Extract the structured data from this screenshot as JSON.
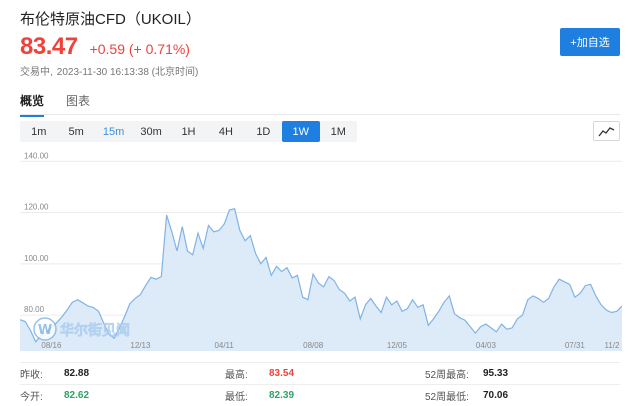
{
  "header": {
    "title": "布伦特原油CFD（UKOIL）",
    "price": "83.47",
    "change": "+0.59 (+ 0.71%)",
    "status_label": "交易中,",
    "timestamp": "2023-11-30 16:13:38 (北京时间)",
    "add_button_label": "+加自选"
  },
  "tabs": [
    {
      "label": "概览",
      "active": true
    },
    {
      "label": "图表",
      "active": false
    }
  ],
  "periods": [
    {
      "label": "1m"
    },
    {
      "label": "5m"
    },
    {
      "label": "15m",
      "highlight": true
    },
    {
      "label": "30m"
    },
    {
      "label": "1H"
    },
    {
      "label": "4H"
    },
    {
      "label": "1D"
    },
    {
      "label": "1W",
      "active": true
    },
    {
      "label": "1M"
    }
  ],
  "chart_type_icon": "line-chart-icon",
  "watermark": "华尔街见闻",
  "colors": {
    "up": "#f0413b",
    "down": "#2ea266",
    "accent": "#1e7fe0",
    "area_fill": "#ddebf9",
    "area_line": "#7fb3e6"
  },
  "chart_data": {
    "type": "area",
    "title": "",
    "xlabel": "",
    "ylabel": "",
    "y_ticks": [
      "140.00",
      "120.00",
      "100.00",
      "80.00"
    ],
    "x_ticks": [
      {
        "label": "08/16",
        "index": 6
      },
      {
        "label": "12/13",
        "index": 23
      },
      {
        "label": "04/11",
        "index": 39
      },
      {
        "label": "08/08",
        "index": 56
      },
      {
        "label": "12/05",
        "index": 72
      },
      {
        "label": "04/03",
        "index": 89
      },
      {
        "label": "07/31",
        "index": 106
      },
      {
        "label": "11/2",
        "index": 122
      }
    ],
    "ylim": [
      66,
      144
    ],
    "grid": true,
    "values": [
      78.2,
      77.5,
      74.0,
      69.6,
      72.0,
      73.6,
      75.3,
      77.0,
      79.3,
      82.0,
      85.0,
      86.0,
      84.8,
      83.5,
      83.0,
      81.5,
      76.8,
      72.5,
      71.0,
      75.0,
      79.5,
      84.5,
      86.5,
      88.0,
      91.5,
      94.7,
      94.0,
      95.0,
      119.0,
      112.5,
      105.0,
      114.5,
      105.0,
      103.5,
      112.0,
      106.0,
      115.0,
      112.5,
      113.0,
      115.5,
      121.0,
      121.5,
      113.0,
      109.0,
      111.0,
      104.0,
      100.0,
      102.5,
      95.5,
      99.0,
      97.0,
      98.5,
      94.5,
      95.5,
      87.0,
      86.0,
      96.0,
      92.5,
      91.0,
      95.0,
      93.5,
      90.0,
      88.5,
      85.5,
      87.0,
      78.5,
      84.0,
      86.5,
      83.5,
      81.0,
      87.0,
      84.0,
      85.5,
      81.5,
      82.5,
      86.0,
      83.0,
      84.0,
      76.0,
      78.5,
      81.5,
      85.0,
      87.5,
      80.5,
      79.0,
      78.0,
      75.5,
      73.0,
      75.5,
      76.5,
      75.0,
      73.5,
      76.5,
      74.5,
      75.0,
      78.5,
      80.0,
      86.0,
      87.5,
      86.5,
      85.0,
      86.5,
      91.0,
      94.0,
      93.0,
      92.0,
      87.0,
      88.5,
      91.5,
      92.0,
      87.5,
      84.0,
      82.0,
      81.0,
      81.5,
      83.5
    ]
  },
  "stats": [
    [
      {
        "label": "昨收:",
        "value": "82.88",
        "color": "dark"
      },
      {
        "label": "最高:",
        "value": "83.54",
        "color": "red"
      },
      {
        "label": "52周最高:",
        "value": "95.33",
        "color": "dark"
      }
    ],
    [
      {
        "label": "今开:",
        "value": "82.62",
        "color": "green"
      },
      {
        "label": "最低:",
        "value": "82.39",
        "color": "green"
      },
      {
        "label": "52周最低:",
        "value": "70.06",
        "color": "dark"
      }
    ]
  ]
}
